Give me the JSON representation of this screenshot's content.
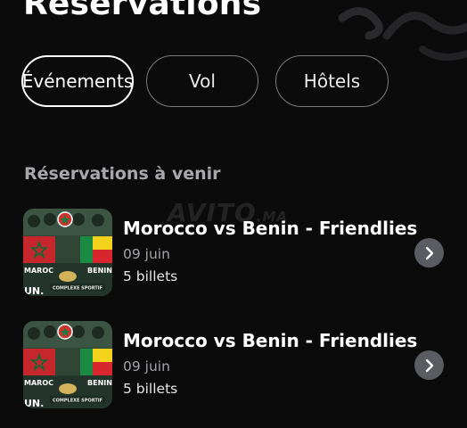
{
  "header": {
    "title": "Réservations"
  },
  "tabs": [
    {
      "label": "Événements",
      "active": true
    },
    {
      "label": "Vol",
      "active": false
    },
    {
      "label": "Hôtels",
      "active": false
    }
  ],
  "section": {
    "title": "Réservations à venir"
  },
  "watermark": {
    "text": "AVITO",
    "suffix": ".MA"
  },
  "reservations": [
    {
      "title": "Morocco vs Benin - Friendlies",
      "date": "09 juin",
      "tickets": "5 billets",
      "thumb": {
        "left_label": "MAROC",
        "right_label": "BENIN",
        "bottom_label": "UN.",
        "banner": "COMPLEXE SPORTIF"
      }
    },
    {
      "title": "Morocco vs Benin - Friendlies",
      "date": "09 juin",
      "tickets": "5 billets",
      "thumb": {
        "left_label": "MAROC",
        "right_label": "BENIN",
        "bottom_label": "UN.",
        "banner": "COMPLEXE SPORTIF"
      }
    }
  ],
  "icons": {
    "row_action": "chevron-right-icon"
  },
  "colors": {
    "background": "#0b0b0c",
    "chevron_bg": "#5b5c62",
    "muted_text": "#a3a3a7"
  }
}
